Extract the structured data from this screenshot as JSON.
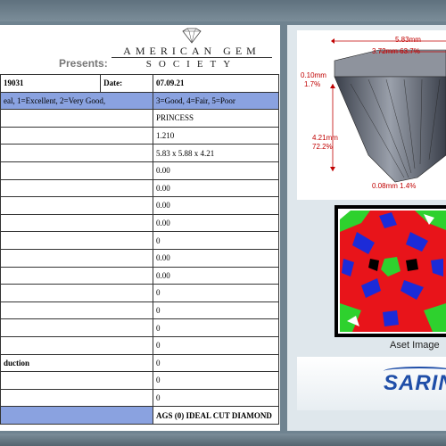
{
  "header": {
    "presents": "Presents:",
    "logo_top": "AMERICAN GEM",
    "logo_bottom": "SOCIETY"
  },
  "report": {
    "report_no": "19031",
    "date_label": "Date:",
    "date_value": "07.09.21",
    "legend": "eal, 1=Excellent, 2=Very Good,",
    "legend_right": "3=Good, 4=Fair, 5=Poor",
    "rows": [
      {
        "label": "",
        "value": "PRINCESS"
      },
      {
        "label": "",
        "value": "1.210"
      },
      {
        "label": "",
        "value": "5.83 x 5.88 x 4.21"
      },
      {
        "label": "",
        "value": "0.00"
      },
      {
        "label": "",
        "value": "0.00"
      },
      {
        "label": "",
        "value": "0.00"
      },
      {
        "label": "",
        "value": "0.00"
      },
      {
        "label": "",
        "value": "0"
      },
      {
        "label": "",
        "value": "0.00"
      },
      {
        "label": "",
        "value": "0.00"
      },
      {
        "label": "",
        "value": "0"
      },
      {
        "label": "",
        "value": "0"
      },
      {
        "label": "",
        "value": "0"
      },
      {
        "label": "",
        "value": "0"
      },
      {
        "label": "duction",
        "value": "0"
      },
      {
        "label": "",
        "value": "0"
      },
      {
        "label": "",
        "value": "0"
      }
    ],
    "final_grade": "AGS (0) IDEAL CUT DIAMOND"
  },
  "diagram": {
    "width_label": "5.83mm",
    "table_label": "3.72mm 63.7%",
    "crown_label_mm": "0.10mm",
    "crown_label_pct": "1.7%",
    "depth_label_mm": "4.21mm",
    "depth_label_pct": "72.2%",
    "culet_label": "0.08mm 1.4%"
  },
  "aset": {
    "caption": "Aset Image",
    "colors": {
      "red": "#e8141a",
      "green": "#2ed12e",
      "blue": "#1c2bd8",
      "black": "#000000",
      "white": "#ffffff"
    }
  },
  "sarin": {
    "logo_text": "SARIN"
  }
}
